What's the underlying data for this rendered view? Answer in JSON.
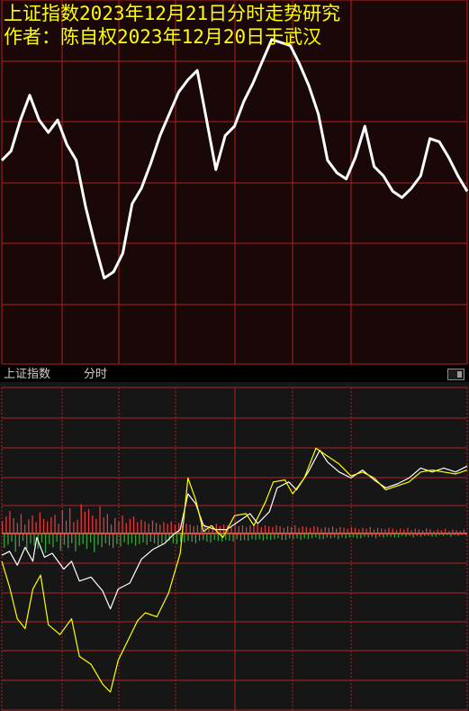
{
  "header": {
    "title": "上证指数2023年12月21日分时走势研究",
    "author": "作者：陈自权2023年12月20日于武汉"
  },
  "pane": {
    "name": "上证指数",
    "mode": "分时"
  },
  "colors": {
    "background": "#000000",
    "upper_background": "#1a0808",
    "lower_background": "#161616",
    "grid": "#b02020",
    "heading_text": "#ffff00",
    "price_line": "#ffffff",
    "index_line": "#ffff00",
    "up_bar": "#e03a3a",
    "down_bar": "#39a33a",
    "toggle_icon": "button-square-icon"
  },
  "chart_data": [
    {
      "type": "line",
      "title": "",
      "grid": true,
      "ylim": [
        0,
        100
      ],
      "xlim": [
        0,
        100
      ],
      "series": [
        {
          "color": "#ffffff",
          "points": [
            [
              0,
              57
            ],
            [
              2,
              60
            ],
            [
              4,
              70
            ],
            [
              6,
              78
            ],
            [
              8,
              70
            ],
            [
              10,
              66
            ],
            [
              12,
              70
            ],
            [
              14,
              62
            ],
            [
              16,
              57
            ],
            [
              18,
              42
            ],
            [
              20,
              30
            ],
            [
              22,
              19
            ],
            [
              24,
              21
            ],
            [
              26,
              27
            ],
            [
              28,
              43
            ],
            [
              30,
              48
            ],
            [
              32,
              56
            ],
            [
              34,
              65
            ],
            [
              36,
              72
            ],
            [
              38,
              79
            ],
            [
              40,
              83
            ],
            [
              42,
              86
            ],
            [
              44,
              70
            ],
            [
              46,
              54
            ],
            [
              48,
              65
            ],
            [
              50,
              68
            ],
            [
              52,
              76
            ],
            [
              54,
              82
            ],
            [
              56,
              89
            ],
            [
              58,
              96
            ],
            [
              60,
              95
            ],
            [
              62,
              94
            ],
            [
              64,
              88
            ],
            [
              66,
              81
            ],
            [
              68,
              72
            ],
            [
              70,
              57
            ],
            [
              72,
              53
            ],
            [
              74,
              51
            ],
            [
              76,
              58
            ],
            [
              78,
              68
            ],
            [
              80,
              55
            ],
            [
              82,
              52
            ],
            [
              84,
              47
            ],
            [
              86,
              45
            ],
            [
              88,
              48
            ],
            [
              90,
              52
            ],
            [
              92,
              64
            ],
            [
              94,
              63
            ],
            [
              96,
              58
            ],
            [
              98,
              52
            ],
            [
              100,
              47
            ]
          ]
        }
      ]
    },
    {
      "type": "line",
      "title": "",
      "grid": true,
      "ylim": [
        -100,
        100
      ],
      "xlim": [
        0,
        240
      ],
      "series": [
        {
          "color": "#ffffff",
          "points": [
            [
              0,
              -22
            ],
            [
              4,
              -18
            ],
            [
              8,
              -32
            ],
            [
              12,
              -14
            ],
            [
              16,
              -28
            ],
            [
              18,
              -4
            ],
            [
              22,
              -24
            ],
            [
              26,
              -20
            ],
            [
              32,
              -36
            ],
            [
              36,
              -28
            ],
            [
              40,
              -48
            ],
            [
              46,
              -44
            ],
            [
              52,
              -58
            ],
            [
              56,
              -76
            ],
            [
              60,
              -56
            ],
            [
              66,
              -50
            ],
            [
              72,
              -26
            ],
            [
              78,
              -16
            ],
            [
              84,
              -10
            ],
            [
              88,
              -2
            ],
            [
              92,
              4
            ],
            [
              96,
              40
            ],
            [
              100,
              30
            ],
            [
              104,
              8
            ],
            [
              110,
              4
            ],
            [
              116,
              4
            ],
            [
              122,
              12
            ],
            [
              128,
              20
            ],
            [
              132,
              10
            ],
            [
              138,
              22
            ],
            [
              142,
              46
            ],
            [
              148,
              52
            ],
            [
              152,
              44
            ],
            [
              158,
              62
            ],
            [
              164,
              84
            ],
            [
              168,
              72
            ],
            [
              174,
              62
            ],
            [
              180,
              56
            ],
            [
              186,
              64
            ],
            [
              192,
              54
            ],
            [
              198,
              46
            ],
            [
              204,
              50
            ],
            [
              210,
              56
            ],
            [
              216,
              66
            ],
            [
              222,
              62
            ],
            [
              228,
              66
            ],
            [
              234,
              62
            ],
            [
              240,
              68
            ]
          ]
        },
        {
          "color": "#ffff00",
          "points": [
            [
              0,
              -28
            ],
            [
              4,
              -54
            ],
            [
              8,
              -86
            ],
            [
              12,
              -96
            ],
            [
              16,
              -56
            ],
            [
              20,
              -42
            ],
            [
              24,
              -92
            ],
            [
              30,
              -102
            ],
            [
              36,
              -86
            ],
            [
              40,
              -124
            ],
            [
              46,
              -132
            ],
            [
              52,
              -152
            ],
            [
              56,
              -160
            ],
            [
              60,
              -128
            ],
            [
              66,
              -104
            ],
            [
              70,
              -88
            ],
            [
              74,
              -80
            ],
            [
              80,
              -84
            ],
            [
              86,
              -60
            ],
            [
              92,
              -20
            ],
            [
              96,
              56
            ],
            [
              100,
              34
            ],
            [
              104,
              2
            ],
            [
              108,
              8
            ],
            [
              114,
              -4
            ],
            [
              120,
              18
            ],
            [
              126,
              20
            ],
            [
              130,
              8
            ],
            [
              136,
              32
            ],
            [
              140,
              52
            ],
            [
              146,
              54
            ],
            [
              150,
              40
            ],
            [
              156,
              56
            ],
            [
              162,
              86
            ],
            [
              168,
              78
            ],
            [
              174,
              70
            ],
            [
              180,
              58
            ],
            [
              186,
              62
            ],
            [
              192,
              56
            ],
            [
              198,
              44
            ],
            [
              204,
              48
            ],
            [
              210,
              52
            ],
            [
              216,
              62
            ],
            [
              222,
              64
            ],
            [
              228,
              62
            ],
            [
              234,
              60
            ],
            [
              240,
              64
            ]
          ]
        }
      ]
    },
    {
      "type": "bar",
      "title": "",
      "xlim": [
        0,
        240
      ],
      "ylim": [
        -100,
        100
      ],
      "values": [
        30,
        -35,
        42,
        -28,
        55,
        -20,
        38,
        -45,
        26,
        -32,
        48,
        -18,
        22,
        -40,
        35,
        -25,
        44,
        -30,
        28,
        -38,
        52,
        -22,
        36,
        -48,
        30,
        -26,
        40,
        -34,
        46,
        -20,
        24,
        -42,
        58,
        -28,
        32,
        -36,
        62,
        -24,
        28,
        -44,
        34,
        -30,
        72,
        -26,
        54,
        -38,
        60,
        -22,
        44,
        -46,
        36,
        -28,
        66,
        -34,
        40,
        -24,
        48,
        -30,
        22,
        -36,
        38,
        -26,
        30,
        -32,
        44,
        -22,
        26,
        -28,
        36,
        -24,
        42,
        -30,
        28,
        -26,
        34,
        -22,
        30,
        -28,
        24,
        -20,
        32,
        -24,
        26,
        -30,
        22,
        -26,
        28,
        -22,
        24,
        -18,
        30,
        -24,
        22,
        -26,
        26,
        -20,
        20,
        -22,
        24,
        -18,
        22,
        -20,
        18,
        -24,
        20,
        -18,
        24,
        -16,
        22,
        -20,
        18,
        -22,
        20,
        -16,
        24,
        -18,
        18,
        -20,
        22,
        -16,
        20,
        -18,
        16,
        -20,
        22,
        -14,
        18,
        -18,
        20,
        -16,
        16,
        -18,
        20,
        -14,
        18,
        -16,
        22,
        -14,
        16,
        -18,
        20,
        -14,
        18,
        -16,
        16,
        -14,
        20,
        -12,
        18,
        -16,
        14,
        -16,
        18,
        -12,
        16,
        -14,
        20,
        -12,
        14,
        -16,
        18,
        -12,
        16,
        -14,
        14,
        -12,
        18,
        -10,
        16,
        -14,
        12,
        -14,
        16,
        -10,
        14,
        -12,
        18,
        -10,
        12,
        -14,
        16,
        -10,
        14,
        -12,
        12,
        -10,
        16,
        -10,
        14,
        -12,
        10,
        -12,
        14,
        -8,
        12,
        -10,
        16,
        -8,
        10,
        -12,
        14,
        -8,
        12,
        -10,
        10,
        -8,
        14,
        -8,
        12,
        -10,
        8,
        -10,
        12,
        -6,
        10,
        -8,
        14,
        -6,
        8,
        -10,
        12,
        -6,
        10,
        -8,
        8,
        -6,
        12,
        -6,
        10,
        -8,
        6,
        -8,
        10,
        -4,
        8,
        -6,
        12,
        -4,
        6,
        -8,
        10,
        -4,
        8,
        -6,
        6,
        -4,
        10,
        -4
      ]
    }
  ]
}
